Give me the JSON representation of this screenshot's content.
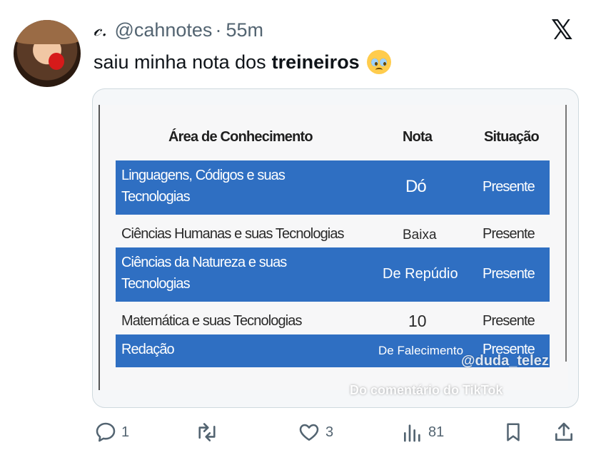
{
  "tweet": {
    "display_name": "𝒸.",
    "handle": "@cahnotes",
    "separator": "·",
    "time": "55m",
    "text_regular": "saiu minha nota dos",
    "text_bold": "treineiros",
    "emoji": "pleading-face-emoji"
  },
  "platform_logo": "𝕏",
  "media": {
    "headers": {
      "area": "Área de Conhecimento",
      "nota": "Nota",
      "situacao": "Situação"
    },
    "rows": [
      {
        "area_line1": "Linguagens, Códigos e suas",
        "area_line2": "Tecnologias",
        "nota": "Dó",
        "situacao": "Presente",
        "highlight": true
      },
      {
        "area_line1": "Ciências Humanas e suas Tecnologias",
        "area_line2": "",
        "nota": "Baixa",
        "situacao": "Presente",
        "highlight": false
      },
      {
        "area_line1": "Ciências da Natureza e suas",
        "area_line2": "Tecnologias",
        "nota": "De Repúdio",
        "situacao": "Presente",
        "highlight": true
      },
      {
        "area_line1": "Matemática e suas Tecnologias",
        "area_line2": "",
        "nota": "10",
        "situacao": "Presente",
        "highlight": false
      },
      {
        "area_line1": "Redação",
        "area_line2": "",
        "nota": "De Falecimento",
        "situacao": "Presente",
        "highlight": true
      }
    ],
    "watermark_handle": "@duda_telez",
    "watermark_caption": "Do comentário do TikTok"
  },
  "actions": {
    "reply_count": "1",
    "retweet_count": "",
    "like_count": "3",
    "views_count": "81"
  },
  "colors": {
    "accent_blue": "#2f6fc2",
    "secondary_text": "#536471"
  }
}
